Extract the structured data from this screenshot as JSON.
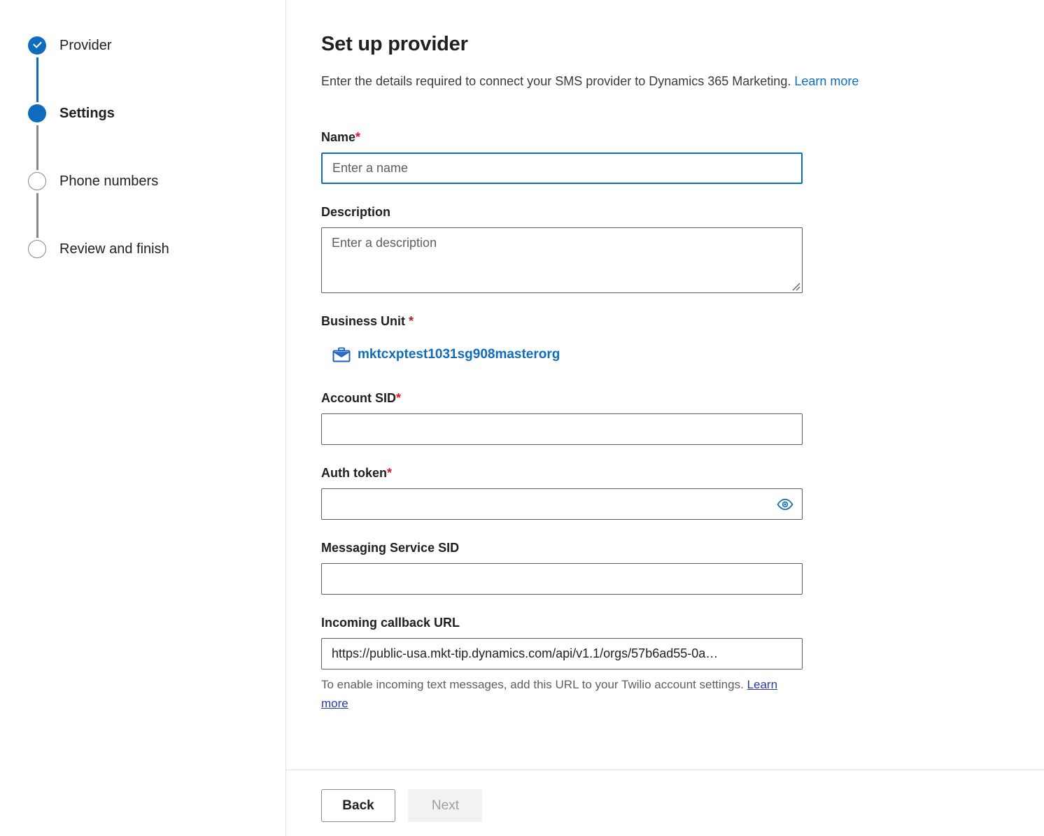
{
  "wizard": {
    "steps": [
      {
        "label": "Provider",
        "state": "completed"
      },
      {
        "label": "Settings",
        "state": "current"
      },
      {
        "label": "Phone numbers",
        "state": "pending"
      },
      {
        "label": "Review and finish",
        "state": "pending"
      }
    ]
  },
  "header": {
    "title": "Set up provider",
    "subtitle": "Enter the details required to connect your SMS provider to Dynamics 365 Marketing.",
    "learn_more_label": "Learn more"
  },
  "form": {
    "name": {
      "label": "Name",
      "required_mark": "*",
      "value": "",
      "placeholder": "Enter a name"
    },
    "description": {
      "label": "Description",
      "value": "",
      "placeholder": "Enter a description"
    },
    "business_unit": {
      "label": "Business Unit ",
      "required_mark": "*",
      "icon": "briefcase-icon",
      "value": "mktcxptest1031sg908masterorg"
    },
    "account_sid": {
      "label": "Account SID",
      "required_mark": "*",
      "value": "",
      "placeholder": ""
    },
    "auth_token": {
      "label": "Auth token",
      "required_mark": "*",
      "value": "",
      "placeholder": "",
      "reveal_icon": "eye-icon"
    },
    "messaging_service_sid": {
      "label": "Messaging Service SID",
      "value": "",
      "placeholder": ""
    },
    "incoming_callback_url": {
      "label": "Incoming callback URL",
      "value": "https://public-usa.mkt-tip.dynamics.com/api/v1.1/orgs/57b6ad55-0a…",
      "hint": "To enable incoming text messages, add this URL to your Twilio account settings.",
      "hint_link_label": "Learn more"
    }
  },
  "footer": {
    "back_label": "Back",
    "next_label": "Next",
    "next_disabled": true
  },
  "colors": {
    "accent": "#0f6cbd",
    "link": "#0f6cbd",
    "required_red": "#e81123",
    "required_dark_red": "#a4262c",
    "border": "#605e5c",
    "divider": "#e1dfdd",
    "disabled_bg": "#f3f2f1",
    "disabled_text": "#a19f9d",
    "hint_text": "#605e5c"
  }
}
